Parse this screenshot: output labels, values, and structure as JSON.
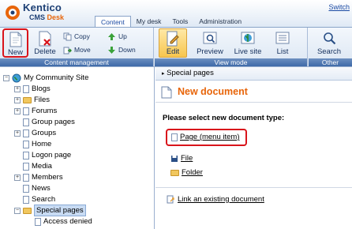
{
  "header": {
    "logo_line1": "Kentico",
    "logo_line2_a": "CMS",
    "logo_line2_b": "Desk",
    "switch_link": "Switch",
    "tabs": [
      {
        "label": "Content"
      },
      {
        "label": "My desk"
      },
      {
        "label": "Tools"
      },
      {
        "label": "Administration"
      }
    ]
  },
  "ribbon": {
    "content_management": {
      "label": "Content management",
      "new": "New",
      "delete": "Delete",
      "copy": "Copy",
      "move": "Move",
      "up": "Up",
      "down": "Down"
    },
    "view_mode": {
      "label": "View mode",
      "edit": "Edit",
      "preview": "Preview",
      "live_site": "Live site",
      "list": "List"
    },
    "other": {
      "label": "Other",
      "search": "Search"
    }
  },
  "tree": {
    "root": "My Community Site",
    "nodes": [
      {
        "label": "Blogs"
      },
      {
        "label": "Files"
      },
      {
        "label": "Forums"
      },
      {
        "label": "Group pages"
      },
      {
        "label": "Groups"
      },
      {
        "label": "Home"
      },
      {
        "label": "Logon page"
      },
      {
        "label": "Media"
      },
      {
        "label": "Members"
      },
      {
        "label": "News"
      },
      {
        "label": "Search"
      },
      {
        "label": "Special pages"
      },
      {
        "label": "Access denied"
      }
    ]
  },
  "main": {
    "breadcrumb": "Special pages",
    "title": "New document",
    "prompt": "Please select new document type:",
    "doc_types": [
      {
        "label": "Page (menu item)"
      },
      {
        "label": "File"
      },
      {
        "label": "Folder"
      }
    ],
    "link_existing": "Link an existing document"
  },
  "colors": {
    "accent_orange": "#e8650a",
    "highlight_red": "#d9141b",
    "brand_blue": "#1d3f74"
  }
}
